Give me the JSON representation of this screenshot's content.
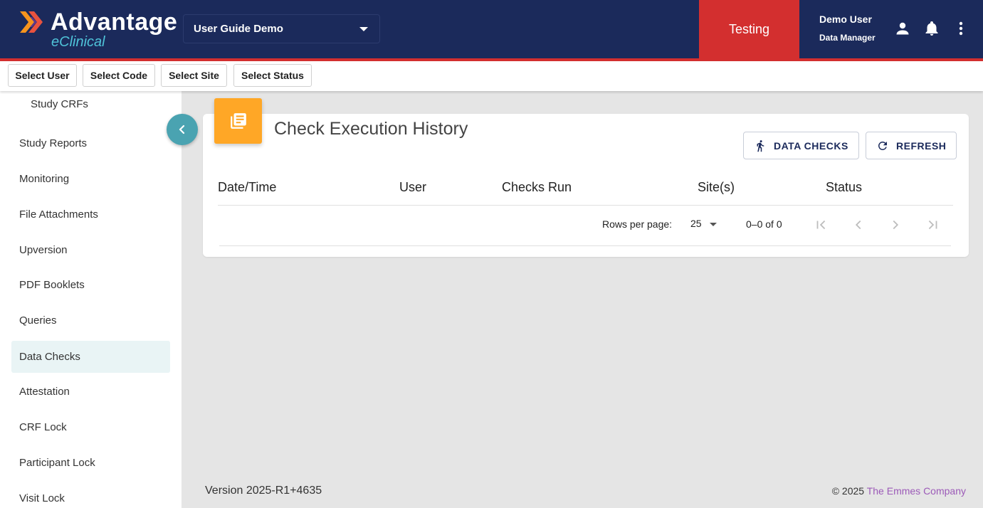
{
  "header": {
    "logo_title": "Advantage",
    "logo_subtitle": "eClinical",
    "study_selected": "User Guide Demo",
    "environment": "Testing",
    "user_name": "Demo User",
    "user_role": "Data Manager",
    "icons": [
      "account-icon",
      "bell-icon",
      "more-vert-icon"
    ],
    "colors": {
      "bar": "#1b2a5b",
      "environment": "#d32f2f",
      "logo_sub": "#4fc3d9"
    }
  },
  "filters": [
    "Select User",
    "Select Code",
    "Select Site",
    "Select Status"
  ],
  "sidebar": {
    "sub_item": "Study CRFs",
    "items": [
      {
        "label": "Study Reports",
        "active": false
      },
      {
        "label": "Monitoring",
        "active": false
      },
      {
        "label": "File Attachments",
        "active": false
      },
      {
        "label": "Upversion",
        "active": false
      },
      {
        "label": "PDF Booklets",
        "active": false
      },
      {
        "label": "Queries",
        "active": false
      },
      {
        "label": "Data Checks",
        "active": true
      },
      {
        "label": "Attestation",
        "active": false
      },
      {
        "label": "CRF Lock",
        "active": false
      },
      {
        "label": "Participant Lock",
        "active": false
      },
      {
        "label": "Visit Lock",
        "active": false
      }
    ]
  },
  "main": {
    "title": "Check Execution History",
    "buttons": {
      "data_checks": "DATA CHECKS",
      "refresh": "REFRESH"
    },
    "columns": [
      "Date/Time",
      "User",
      "Checks Run",
      "Site(s)",
      "Status"
    ],
    "pagination": {
      "rows_label": "Rows per page:",
      "rows_value": "25",
      "range": "0–0 of 0"
    },
    "icon_color": "#ffa726"
  },
  "footer": {
    "version": "Version 2025-R1+4635",
    "copyright": "© 2025",
    "company": "The Emmes Company"
  }
}
